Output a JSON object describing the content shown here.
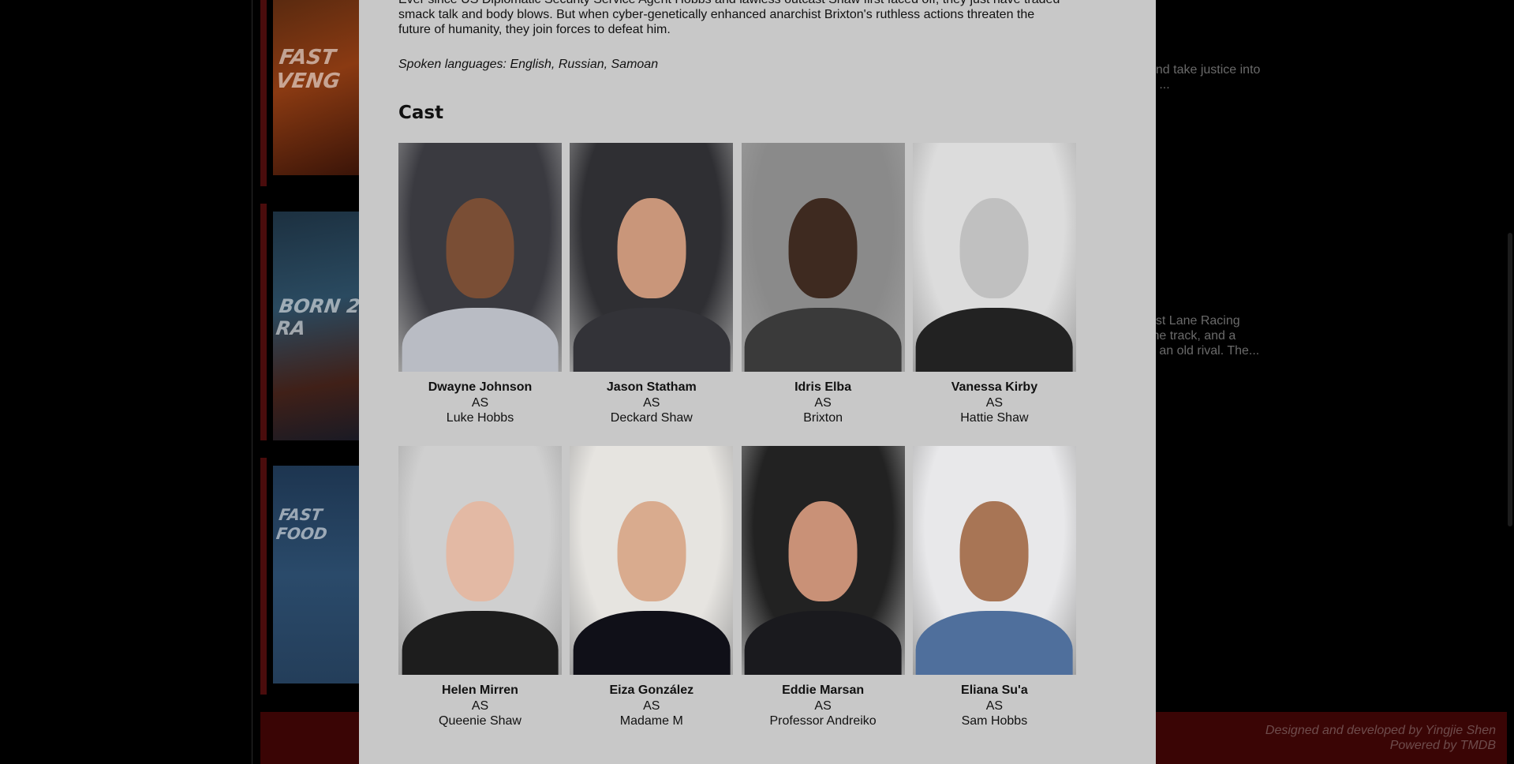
{
  "background": {
    "posters": [
      {
        "title": "FAST VENG"
      },
      {
        "title": "BORN 2 RA"
      },
      {
        "title": "FAST FOOD"
      }
    ],
    "snippets": [
      {
        "text": "and take justice into\ne ..."
      },
      {
        "text": "ast Lane Racing\n the track, and a\nh an old rival. The..."
      }
    ],
    "footer": {
      "line1": "Designed and developed by Yingjie Shen",
      "line2": "Powered by TMDB"
    }
  },
  "modal": {
    "overview": "Ever since US Diplomatic Security Service Agent Hobbs and lawless outcast Shaw first faced off, they just have traded smack talk and body blows. But when cyber-genetically enhanced anarchist Brixton's ruthless actions threaten the future of humanity, they join forces to defeat him.",
    "languages": "Spoken languages: English, Russian, Samoan",
    "cast_heading": "Cast",
    "cast": [
      {
        "actor": "Dwayne Johnson",
        "as": "AS",
        "character": "Luke Hobbs",
        "bg": "#3a3a40",
        "skin": "#7a4e35",
        "cloth": "#b9bcc4"
      },
      {
        "actor": "Jason Statham",
        "as": "AS",
        "character": "Deckard Shaw",
        "bg": "#2f2f33",
        "skin": "#c9967a",
        "cloth": "#333338"
      },
      {
        "actor": "Idris Elba",
        "as": "AS",
        "character": "Brixton",
        "bg": "#8a8a8a",
        "skin": "#3e2a20",
        "cloth": "#3a3a3a"
      },
      {
        "actor": "Vanessa Kirby",
        "as": "AS",
        "character": "Hattie Shaw",
        "bg": "#dcdcdc",
        "skin": "#c0c0c0",
        "cloth": "#222222"
      },
      {
        "actor": "Helen Mirren",
        "as": "AS",
        "character": "Queenie Shaw",
        "bg": "#cfcfcf",
        "skin": "#e3b9a4",
        "cloth": "#1d1d1d"
      },
      {
        "actor": "Eiza González",
        "as": "AS",
        "character": "Madame M",
        "bg": "#e6e4e0",
        "skin": "#d9ab8e",
        "cloth": "#101018"
      },
      {
        "actor": "Eddie Marsan",
        "as": "AS",
        "character": "Professor Andreiko",
        "bg": "#222222",
        "skin": "#c99177",
        "cloth": "#1a1a1e"
      },
      {
        "actor": "Eliana Su'a",
        "as": "AS",
        "character": "Sam Hobbs",
        "bg": "#e8e8ea",
        "skin": "#a87555",
        "cloth": "#4f6f9c"
      }
    ]
  }
}
